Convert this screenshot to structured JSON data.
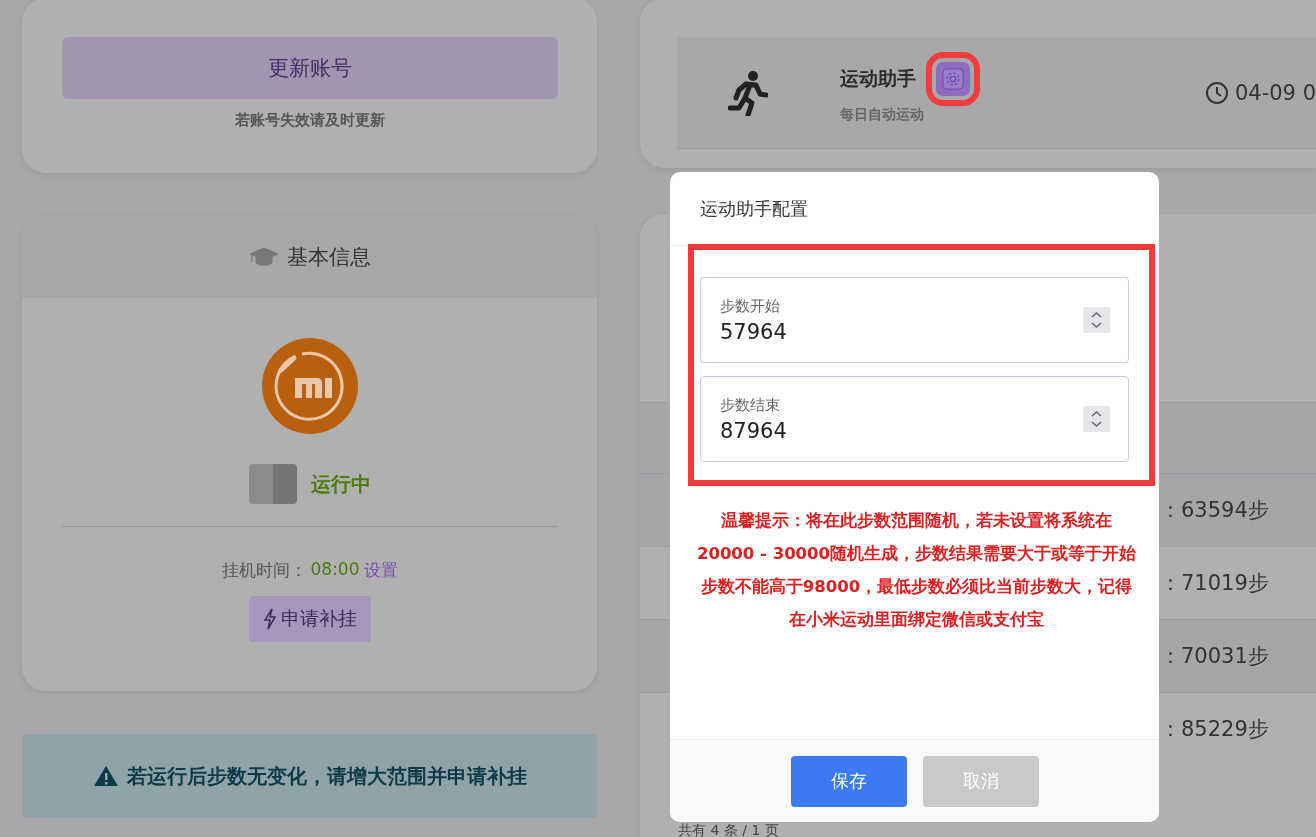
{
  "account_card": {
    "update_button": "更新账号",
    "hint": "若账号失效请及时更新"
  },
  "info_card": {
    "title": "基本信息",
    "status": "运行中",
    "time_label": "挂机时间：",
    "time_value": "08:00",
    "time_link": "设置",
    "apply_button": "申请补挂"
  },
  "alert": {
    "text": "若运行后步数无变化，请增大范围并申请补挂"
  },
  "task_card": {
    "title": "运动助手",
    "subtitle": "每日自动运动",
    "time": "04-09 0"
  },
  "records": [
    {
      "steps": "：63594步"
    },
    {
      "steps": "：71019步"
    },
    {
      "steps": "：70031步"
    },
    {
      "steps": "：85229步"
    }
  ],
  "pagination": "共有 4 条 / 1 页",
  "dialog": {
    "title": "运动助手配置",
    "fields": [
      {
        "label": "步数开始",
        "value": "57964"
      },
      {
        "label": "步数结束",
        "value": "87964"
      }
    ],
    "tip": "温馨提示：将在此步数范围随机，若未设置将系统在20000 - 30000随机生成，步数结果需要大于或等于开始步数不能高于98000，最低步数必须比当前步数大，记得在小米运动里面绑定微信或支付宝",
    "buttons": [
      {
        "label": "保存",
        "kind": "primary"
      },
      {
        "label": "取消",
        "kind": "secondary"
      }
    ]
  }
}
